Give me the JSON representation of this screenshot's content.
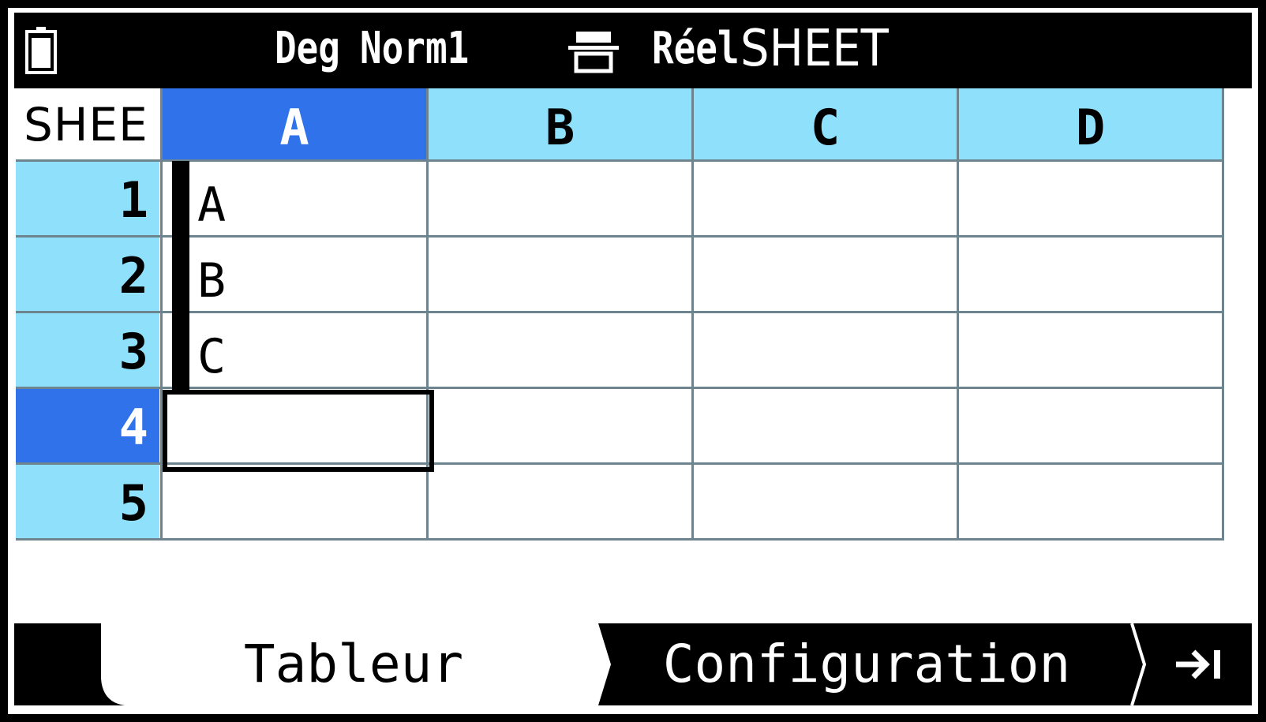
{
  "status": {
    "mode_angle": "Deg",
    "mode_display": "Norm1",
    "mode_number": "Réel",
    "app_name": "SHEET",
    "battery_icon": "battery-icon",
    "lock_icon": "input-mode-icon"
  },
  "sheet": {
    "name": "SHEE",
    "columns": [
      "A",
      "B",
      "C",
      "D"
    ],
    "rows": [
      "1",
      "2",
      "3",
      "4",
      "5"
    ],
    "cells": [
      [
        "A",
        "",
        "",
        ""
      ],
      [
        "B",
        "",
        "",
        ""
      ],
      [
        "C",
        "",
        "",
        ""
      ],
      [
        "",
        "",
        "",
        ""
      ],
      [
        "",
        "",
        "",
        ""
      ]
    ],
    "active_column": "A",
    "active_row": "4",
    "colors": {
      "header": "#8fe0fa",
      "active_header": "#2f72ea",
      "grid": "#6e8590"
    }
  },
  "menu": {
    "tab_active": "Tableur",
    "tab_config": "Configuration",
    "next_icon": "jump-to-end-icon"
  }
}
